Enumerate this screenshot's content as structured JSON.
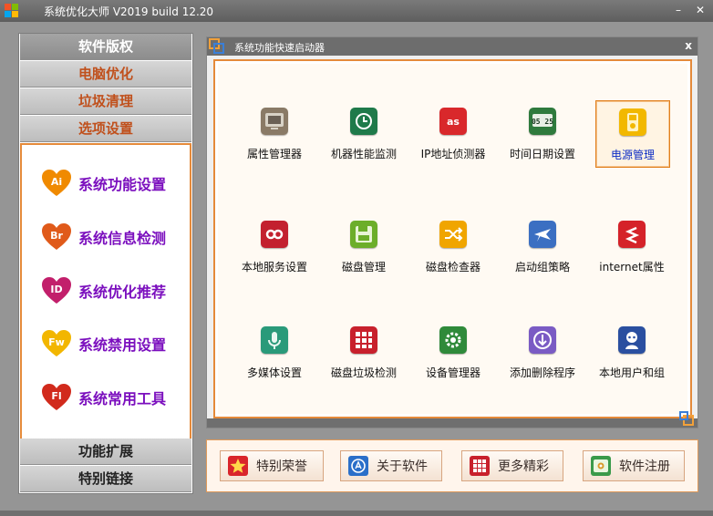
{
  "window": {
    "title": "系统优化大师 V2019 build 12.20",
    "controls": {
      "minimize": "–",
      "maximize": "□",
      "close": "✕"
    }
  },
  "sidebar": {
    "top_buttons": [
      {
        "label": "软件版权",
        "state": "active"
      },
      {
        "label": "电脑优化",
        "state": "red"
      },
      {
        "label": "垃圾清理",
        "state": "red"
      },
      {
        "label": "选项设置",
        "state": "red"
      }
    ],
    "items": [
      {
        "badge": "Ai",
        "label": "系统功能设置",
        "color": "#f08a00"
      },
      {
        "badge": "Br",
        "label": "系统信息检测",
        "color": "#e05a1a"
      },
      {
        "badge": "ID",
        "label": "系统优化推荐",
        "color": "#c21f6b"
      },
      {
        "badge": "Fw",
        "label": "系统禁用设置",
        "color": "#f2b600"
      },
      {
        "badge": "Fl",
        "label": "系统常用工具",
        "color": "#d12a1c"
      }
    ],
    "bottom_buttons": [
      {
        "label": "功能扩展"
      },
      {
        "label": "特别链接"
      }
    ]
  },
  "panel": {
    "title": "系统功能快速启动器",
    "close": "x",
    "tiles": [
      {
        "label": "属性管理器",
        "icon": "monitor-icon",
        "color": "#8a7a66"
      },
      {
        "label": "机器性能监测",
        "icon": "clock-history-icon",
        "color": "#1f7a4a"
      },
      {
        "label": "IP地址侦测器",
        "icon": "lastfm-icon",
        "color": "#d9282b"
      },
      {
        "label": "时间日期设置",
        "icon": "calendar-clock-icon",
        "color": "#2f7a3d",
        "text": "05 25"
      },
      {
        "label": "电源管理",
        "icon": "ipod-icon",
        "color": "#f2b800",
        "selected": true
      },
      {
        "label": "本地服务设置",
        "icon": "infinity-icon",
        "color": "#c3212f"
      },
      {
        "label": "磁盘管理",
        "icon": "floppy-disk-icon",
        "color": "#6cae2a"
      },
      {
        "label": "磁盘检查器",
        "icon": "shuffle-icon",
        "color": "#f0a500"
      },
      {
        "label": "启动组策略",
        "icon": "airplane-icon",
        "color": "#3b6fc2"
      },
      {
        "label": "internet属性",
        "icon": "lastfm-s-icon",
        "color": "#d52229"
      },
      {
        "label": "多媒体设置",
        "icon": "microphone-icon",
        "color": "#2a9a7a"
      },
      {
        "label": "磁盘垃圾检测",
        "icon": "grid-icon",
        "color": "#c8202c"
      },
      {
        "label": "设备管理器",
        "icon": "gear-icon",
        "color": "#2f8a3a"
      },
      {
        "label": "添加删除程序",
        "icon": "download-icon",
        "color": "#7a5bc4"
      },
      {
        "label": "本地用户和组",
        "icon": "user-icon",
        "color": "#2a4fa0"
      }
    ]
  },
  "bottom_bar": {
    "buttons": [
      {
        "label": "特别荣誉",
        "icon": "star-icon",
        "color": "#d9252b"
      },
      {
        "label": "关于软件",
        "icon": "appstore-icon",
        "color": "#2a6fc9"
      },
      {
        "label": "更多精彩",
        "icon": "grid-icon",
        "color": "#c8202c"
      },
      {
        "label": "软件注册",
        "icon": "photo-icon",
        "color": "#3a9a4a"
      }
    ]
  },
  "colors": {
    "accent_orange": "#e58a3a",
    "sidebar_text_purple": "#7b0fbe",
    "sidebar_red_text": "#c0501c",
    "frame_gray": "#959595"
  }
}
